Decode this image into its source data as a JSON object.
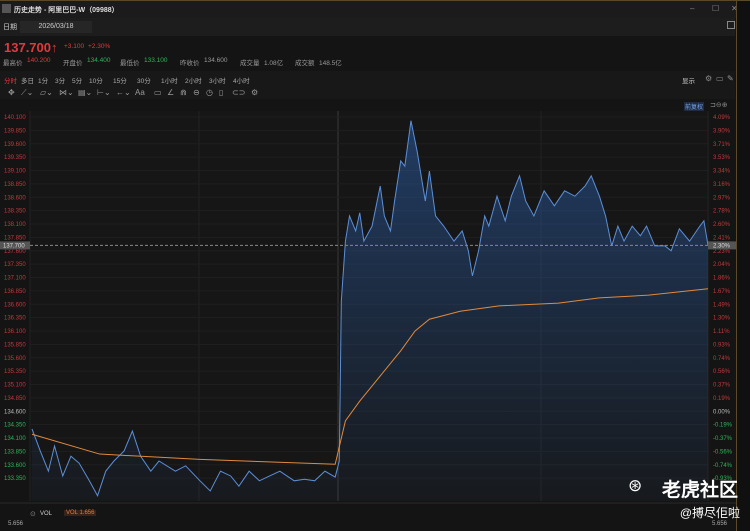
{
  "title": "历史走势 - 阿里巴巴-W（09988）",
  "window": {
    "minimize": "–",
    "maximize": "☐",
    "close": "✕"
  },
  "date_label": "日期",
  "date_value": "2026/03/18",
  "quote": {
    "price": "137.700",
    "arrow": "↑",
    "change": "+3.100",
    "change_pct": "+2.30%"
  },
  "stats": [
    {
      "label": "最高价",
      "value": "140.200",
      "color": "red"
    },
    {
      "label": "开盘价",
      "value": "134.400",
      "color": "green"
    },
    {
      "label": "最低价",
      "value": "133.100",
      "color": "green"
    },
    {
      "label": "昨收价",
      "value": "134.600",
      "color": "gray"
    },
    {
      "label": "成交量",
      "value": "1.08亿",
      "color": "gray"
    },
    {
      "label": "成交额",
      "value": "148.5亿",
      "color": "gray"
    }
  ],
  "timeframes": [
    "分时",
    "多日",
    "1分",
    "3分",
    "5分",
    "10分",
    "15分",
    "30分",
    "1小时",
    "2小时",
    "3小时",
    "4小时"
  ],
  "active_timeframe": "分时",
  "display_label": "显示",
  "adjust_label": "前复权",
  "tools": [
    "move",
    "line",
    "channel",
    "fib",
    "measure",
    "range",
    "arrow",
    "Aa",
    "note",
    "pen",
    "magnet",
    "lock",
    "clock",
    "trash",
    "link",
    "settings"
  ],
  "colors": {
    "up": "#e0393e",
    "down": "#2fb45a",
    "price_line": "#5b8fd8",
    "avg_line": "#e08a3c",
    "bg": "#161616"
  },
  "vol": {
    "label": "VOL",
    "value_label": "VOL 1.656",
    "axis": "5.656"
  },
  "watermark": {
    "brand": "老虎社区",
    "user": "@搏尽佢啦"
  },
  "chart_data": {
    "type": "line",
    "prev_close": 134.6,
    "current": 137.7,
    "ylim": [
      133.2,
      140.2
    ],
    "price_ticks": [
      "140.100",
      "139.850",
      "139.600",
      "139.350",
      "139.100",
      "138.850",
      "138.600",
      "138.350",
      "138.100",
      "137.850",
      "137.600",
      "137.350",
      "137.100",
      "136.850",
      "136.600",
      "136.350",
      "136.100",
      "135.850",
      "135.600",
      "135.350",
      "135.100",
      "134.850",
      "134.600",
      "134.350",
      "134.100",
      "133.850",
      "133.600",
      "133.350"
    ],
    "pct_ticks": [
      "4.09%",
      "3.90%",
      "3.71%",
      "3.53%",
      "3.34%",
      "3.16%",
      "2.97%",
      "2.78%",
      "2.60%",
      "2.41%",
      "2.23%",
      "2.04%",
      "1.86%",
      "1.67%",
      "1.49%",
      "1.30%",
      "1.11%",
      "0.93%",
      "0.74%",
      "0.56%",
      "0.37%",
      "0.19%",
      "0.00%",
      "-0.19%",
      "-0.37%",
      "-0.56%",
      "-0.74%",
      "-0.93%"
    ],
    "current_pct": "2.30%",
    "xlim": [
      0,
      330
    ],
    "series": [
      {
        "name": "price",
        "x": [
          0,
          4,
          8,
          11,
          15,
          19,
          23,
          28,
          32,
          36,
          40,
          45,
          49,
          53,
          58,
          62,
          70,
          75,
          82,
          87,
          92,
          97,
          101,
          106,
          111,
          116,
          121,
          128,
          133,
          138,
          143,
          148,
          150,
          151,
          153,
          155,
          158,
          160,
          162,
          166,
          170,
          172,
          175,
          177,
          180,
          182,
          185,
          188,
          192,
          194,
          197,
          201,
          206,
          210,
          213,
          215,
          218,
          221,
          223,
          227,
          231,
          234,
          238,
          241,
          245,
          250,
          255,
          260,
          265,
          270,
          273,
          277,
          280,
          283,
          286,
          289,
          293,
          297,
          300,
          304,
          309,
          312,
          316,
          321,
          326,
          328,
          330
        ],
        "values": [
          134.27,
          133.86,
          133.48,
          133.95,
          133.39,
          133.76,
          133.63,
          133.3,
          133.02,
          133.48,
          133.67,
          133.86,
          134.23,
          133.76,
          133.48,
          133.67,
          133.48,
          133.58,
          133.3,
          133.11,
          133.48,
          133.39,
          133.2,
          133.48,
          133.3,
          133.39,
          133.48,
          133.3,
          133.33,
          133.3,
          133.48,
          133.37,
          133.67,
          136.66,
          137.78,
          138.25,
          137.97,
          138.31,
          137.78,
          138.06,
          138.81,
          138.25,
          137.97,
          138.53,
          139.28,
          139.18,
          140.03,
          139.46,
          138.53,
          139.09,
          138.25,
          138.06,
          137.78,
          137.97,
          137.6,
          137.13,
          137.6,
          138.25,
          138.06,
          138.62,
          138.16,
          138.62,
          139.0,
          138.53,
          138.25,
          138.72,
          138.44,
          138.72,
          138.62,
          138.81,
          139.0,
          138.62,
          138.25,
          137.69,
          138.06,
          137.78,
          138.06,
          137.88,
          138.06,
          137.69,
          137.69,
          137.6,
          138.01,
          137.78,
          138.06,
          138.16,
          137.7
        ]
      },
      {
        "name": "average",
        "x": [
          0,
          33,
          82,
          148,
          153,
          160,
          170,
          180,
          187,
          194,
          209,
          228,
          257,
          277,
          301,
          330
        ],
        "values": [
          134.17,
          133.8,
          133.7,
          133.61,
          134.42,
          134.79,
          135.26,
          135.73,
          136.1,
          136.32,
          136.47,
          136.57,
          136.62,
          136.72,
          136.77,
          136.89
        ]
      }
    ]
  }
}
